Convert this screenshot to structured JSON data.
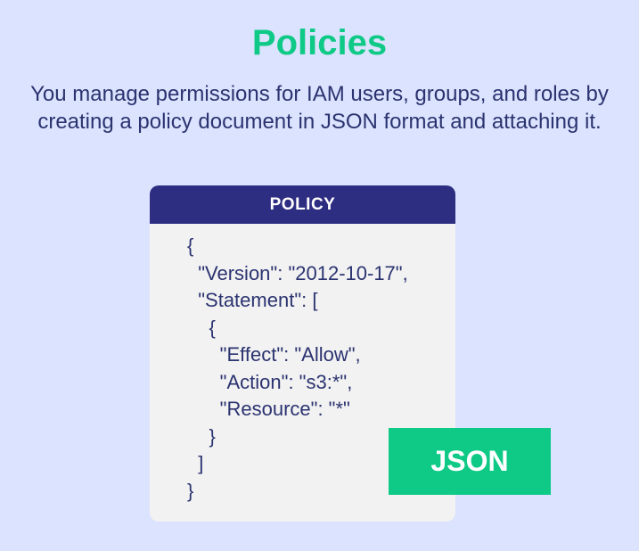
{
  "title": "Policies",
  "subtitle": "You manage permissions for IAM users, groups, and roles by creating a policy document in JSON format and attaching it.",
  "policy": {
    "header": "POLICY",
    "lines": [
      "{",
      "  \"Version\": \"2012-10-17\",",
      "  \"Statement\": [",
      "    {",
      "      \"Effect\": \"Allow\",",
      "      \"Action\": \"s3:*\",",
      "      \"Resource\": \"*\"",
      "    }",
      "  ]",
      "}"
    ]
  },
  "badge": {
    "label": "JSON"
  },
  "colors": {
    "background": "#dbe3fe",
    "accent_green": "#0fca86",
    "navy": "#2d2d82",
    "text": "#2b3370",
    "card": "#f2f2f2"
  }
}
